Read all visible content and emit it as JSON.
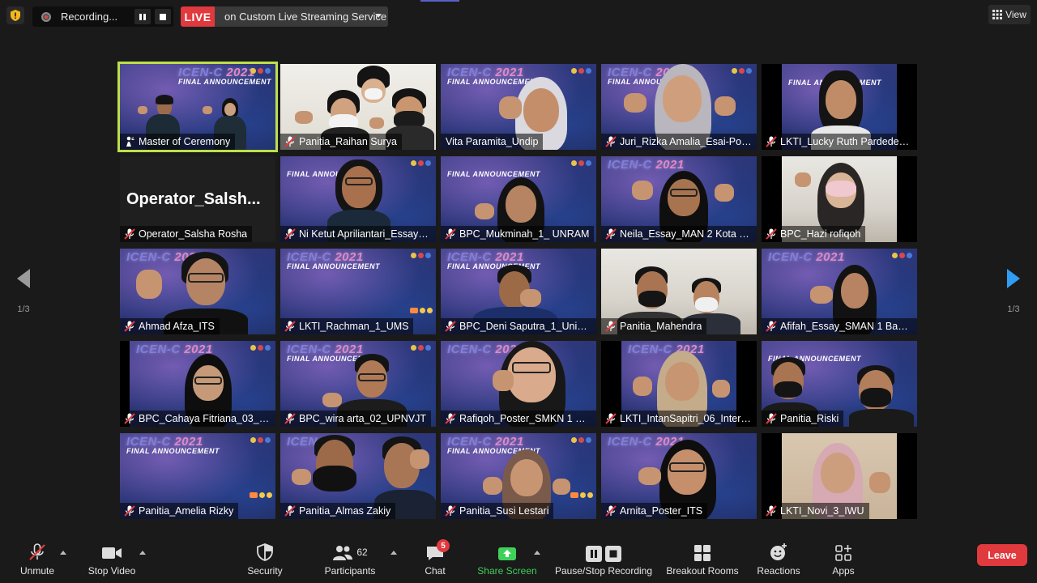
{
  "top_bar": {
    "recording_label": "Recording...",
    "live_label": "LIVE",
    "live_service": "on Custom Live Streaming Service",
    "view_label": "View"
  },
  "banner": {
    "title_a": "ICEN-C",
    "title_b": "2021",
    "subtitle": "FINAL ANNOUNCEMENT"
  },
  "gallery": {
    "page_prev": "1/3",
    "page_next": "1/3",
    "tiles": [
      {
        "name": "Master of Ceremony"
      },
      {
        "name": "Panitia_Raihan Surya"
      },
      {
        "name": "Vita Paramita_Undip"
      },
      {
        "name": "Juri_Rizka Amalia_Esai-Poster"
      },
      {
        "name": "LKTI_Lucky Ruth Pardede_2_..."
      },
      {
        "name": "Operator_Salsha Rosha",
        "big": "Operator_Salsh..."
      },
      {
        "name": "Ni Ketut Apriliantari_Essay_S..."
      },
      {
        "name": "BPC_Mukminah_1_ UNRAM"
      },
      {
        "name": "Neila_Essay_MAN 2 Kota Ke..."
      },
      {
        "name": "BPC_Hazi rofiqoh"
      },
      {
        "name": "Ahmad Afza_ITS"
      },
      {
        "name": "LKTI_Rachman_1_UMS"
      },
      {
        "name": "BPC_Deni Saputra_1_Univer..."
      },
      {
        "name": "Panitia_Mahendra"
      },
      {
        "name": "Afifah_Essay_SMAN 1 Badeg..."
      },
      {
        "name": "BPC_Cahaya Fitriana_03_Uni..."
      },
      {
        "name": "BPC_wira arta_02_UPNVJT"
      },
      {
        "name": "Rafiqoh_Poster_SMKN 1 Kot..."
      },
      {
        "name": "LKTI_IntanSapitri_06_Interna..."
      },
      {
        "name": "Panitia_Riski"
      },
      {
        "name": "Panitia_Amelia Rizky"
      },
      {
        "name": "Panitia_Almas Zakiy"
      },
      {
        "name": "Panitia_Susi Lestari"
      },
      {
        "name": "Arnita_Poster_ITS"
      },
      {
        "name": "LKTI_Novi_3_IWU"
      }
    ]
  },
  "toolbar": {
    "unmute": "Unmute",
    "stop_video": "Stop Video",
    "security": "Security",
    "participants": "Participants",
    "participants_count": "62",
    "chat": "Chat",
    "chat_badge": "5",
    "share_screen": "Share Screen",
    "recording": "Pause/Stop Recording",
    "breakout": "Breakout Rooms",
    "reactions": "Reactions",
    "apps": "Apps",
    "leave": "Leave"
  },
  "colors": {
    "active_speaker_border": "#bde04a",
    "live_red": "#e0393e",
    "share_green": "#3fd05a",
    "banner_blue": "#2b3577"
  }
}
